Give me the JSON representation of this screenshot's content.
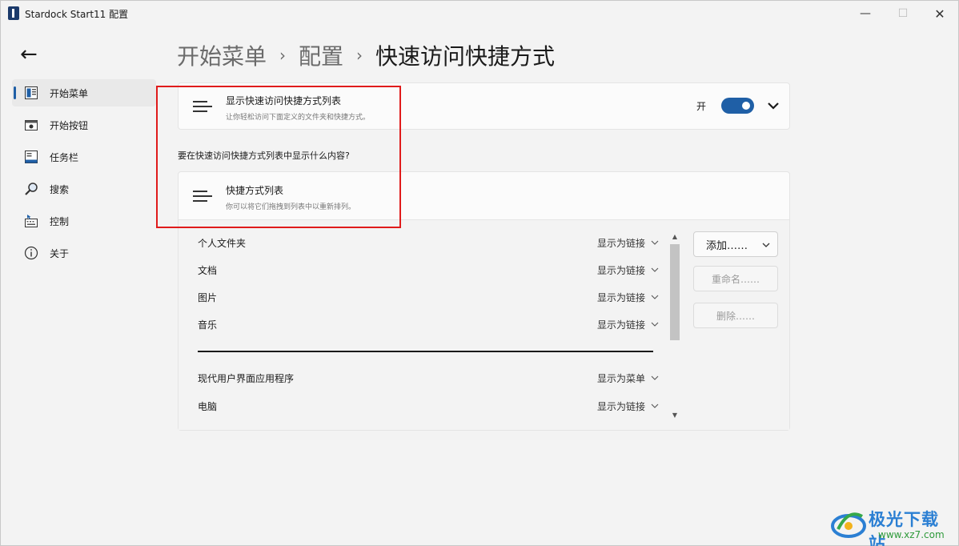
{
  "window": {
    "title": "Stardock Start11 配置",
    "minimize": "—",
    "maximize": "☐",
    "close": "✕"
  },
  "back": "←",
  "sidebar": {
    "items": [
      {
        "label": "开始菜单",
        "icon": "start-menu-icon",
        "active": true
      },
      {
        "label": "开始按钮",
        "icon": "start-button-icon"
      },
      {
        "label": "任务栏",
        "icon": "taskbar-icon"
      },
      {
        "label": "搜索",
        "icon": "search-icon"
      },
      {
        "label": "控制",
        "icon": "control-icon"
      },
      {
        "label": "关于",
        "icon": "info-icon"
      }
    ]
  },
  "breadcrumb": {
    "items": [
      "开始菜单",
      "配置",
      "快速访问快捷方式"
    ],
    "separator": "›"
  },
  "show_list_card": {
    "title": "显示快速访问快捷方式列表",
    "description": "让你轻松访问下面定义的文件夹和快捷方式。",
    "toggle_label": "开",
    "toggle_on": true
  },
  "question": "要在快速访问快捷方式列表中显示什么内容?",
  "shortcut_card": {
    "title": "快捷方式列表",
    "description": "你可以将它们拖拽到列表中以重新排列。",
    "rows": [
      {
        "name": "个人文件夹",
        "value": "显示为链接"
      },
      {
        "name": "文档",
        "value": "显示为链接"
      },
      {
        "name": "图片",
        "value": "显示为链接"
      },
      {
        "name": "音乐",
        "value": "显示为链接"
      },
      {
        "name": "现代用户界面应用程序",
        "value": "显示为菜单"
      },
      {
        "name": "电脑",
        "value": "显示为链接"
      }
    ],
    "buttons": {
      "add": "添加……",
      "rename": "重命名……",
      "delete": "删除……"
    },
    "scroll_up": "▲",
    "scroll_down": "▼"
  },
  "watermark": {
    "name": "极光下载站",
    "url": "www.xz7.com"
  },
  "colors": {
    "accent": "#1f5fa6",
    "highlight": "#e01b1b",
    "background": "#f3f3f3"
  }
}
